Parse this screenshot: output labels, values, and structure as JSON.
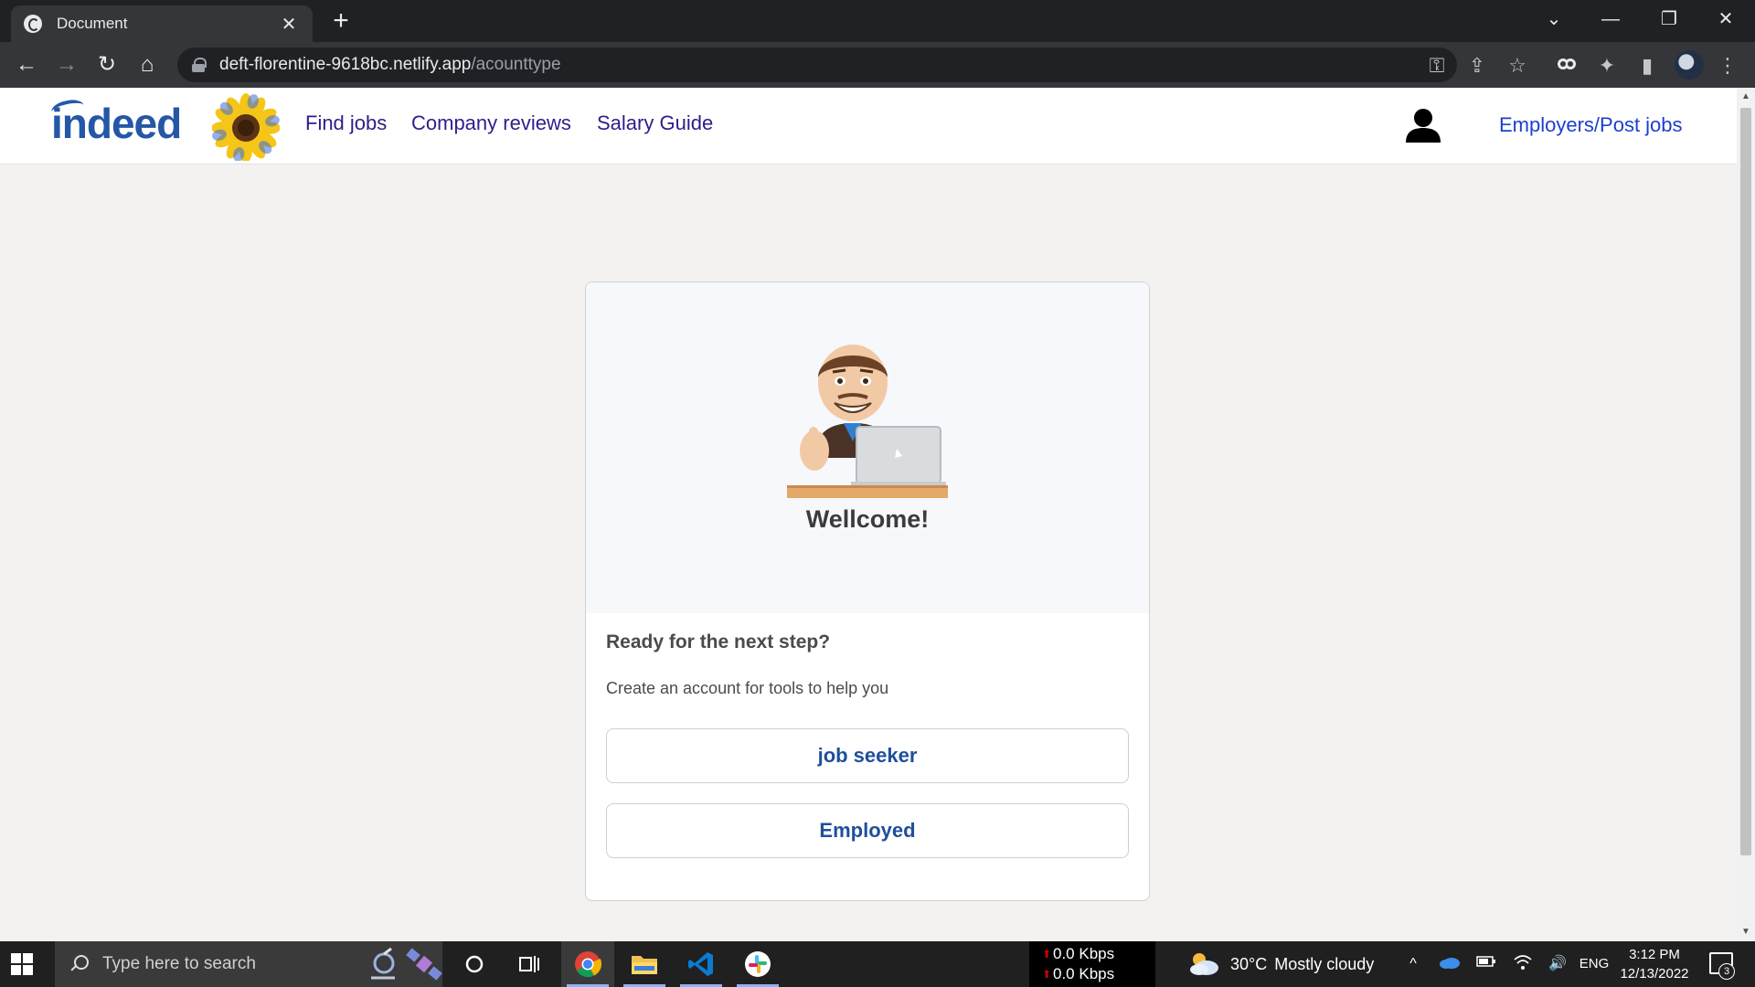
{
  "browser": {
    "tab_title": "Document",
    "tab_close": "✕",
    "new_tab": "+",
    "url_host": "deft-florentine-9618bc.netlify.app",
    "url_path": "/acounttype",
    "window_controls": {
      "tabs_menu": "⌄",
      "minimize": "—",
      "restore": "❐",
      "close": "✕"
    },
    "nav": {
      "back": "←",
      "forward": "→",
      "reload": "↻",
      "home": "⌂"
    },
    "toolbar_icons": {
      "key": "⚿",
      "share": "⇪",
      "star": "☆",
      "extensions": "✦",
      "sidepanel": "▮",
      "menu": "⋮"
    }
  },
  "header": {
    "logo": "indeed",
    "nav_links": [
      "Find jobs",
      "Company reviews",
      "Salary Guide"
    ],
    "employers_link": "Employers/Post jobs"
  },
  "card": {
    "welcome": "Wellcome!",
    "heading": "Ready for the next step?",
    "subtext": "Create an account for tools to help you",
    "buttons": [
      "job seeker",
      "Employed"
    ]
  },
  "taskbar": {
    "search_placeholder": "Type here to search",
    "net_down": "0.0 Kbps",
    "net_up": "0.0 Kbps",
    "net_arrow": "⬆",
    "weather_temp": "30°C",
    "weather_desc": "Mostly cloudy",
    "language": "ENG",
    "time": "3:12 PM",
    "date": "12/13/2022",
    "notifications": "3",
    "tray": {
      "chevron": "^",
      "speaker": "🔊"
    }
  },
  "colors": {
    "indeed_blue": "#2557a7",
    "nav_purple": "#2d1e8a",
    "button_text": "#1f4f9c",
    "page_bg": "#f3f2f1"
  },
  "icons": [
    "globe-icon",
    "lock-icon",
    "key-icon",
    "share-icon",
    "star-icon",
    "puzzle-icon",
    "sidepanel-icon",
    "kebab-menu-icon",
    "sunflower-icon",
    "user-icon",
    "windows-start-icon",
    "search-icon",
    "cortana-icon",
    "task-view-icon",
    "chrome-icon",
    "file-explorer-icon",
    "vscode-icon",
    "slack-icon",
    "cloud-icon",
    "onedrive-icon",
    "battery-icon",
    "wifi-icon",
    "speaker-icon"
  ]
}
